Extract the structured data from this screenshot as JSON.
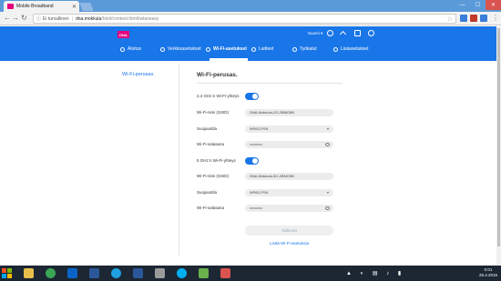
{
  "browser": {
    "tab_title": "Mobile Broadband",
    "tab_close": "✕",
    "security_label": "Ei turvallinen",
    "separator": "|",
    "url_host": "dna.mokkula",
    "url_path": "/html/content.html#wlaneasy",
    "win_min": "—",
    "win_max": "☐",
    "win_close": "✕"
  },
  "header": {
    "logo_text": "DNA",
    "language": "Suomi ▾",
    "menu": [
      {
        "label": "Aloitus"
      },
      {
        "label": "Verkkoasetukset"
      },
      {
        "label": "Wi-Fi-asetukset",
        "active": true
      },
      {
        "label": "Laitteet"
      },
      {
        "label": "Työkalut"
      },
      {
        "label": "Lisäasetukset"
      }
    ]
  },
  "sidebar": {
    "items": [
      {
        "label": "Wi-Fi-perusas."
      }
    ]
  },
  "page": {
    "title": "Wi-Fi-perusas.",
    "wifi24": {
      "toggle_label": "2,4 GHz:n Wi-Fi-yhteys",
      "ssid_label": "Wi-Fi-nimi (SSID)",
      "ssid_value": "DNA-Mokkula-2G-2BMO9B",
      "security_label": "Suojaustila",
      "security_value": "WPA2-PSK",
      "password_label": "Wi-Fi-salasana",
      "password_value": "••••••••••"
    },
    "wifi5": {
      "toggle_label": "5 GHz:n Wi-Fi-yhteys",
      "ssid_label": "Wi-Fi-nimi (SSID)",
      "ssid_value": "DNA-Mokkula-5G-2BMO9B",
      "security_label": "Suojaustila",
      "security_value": "WPA2-PSK",
      "password_label": "Wi-Fi-salasana",
      "password_value": "••••••••••"
    },
    "save_button": "Tallenna",
    "add_link": "Lisää Wi-Fi-asetuksia"
  },
  "taskbar": {
    "time": "0:01",
    "date": "25.4.2016"
  },
  "colors": {
    "accent": "#1976e8",
    "brand": "#e5007d"
  }
}
